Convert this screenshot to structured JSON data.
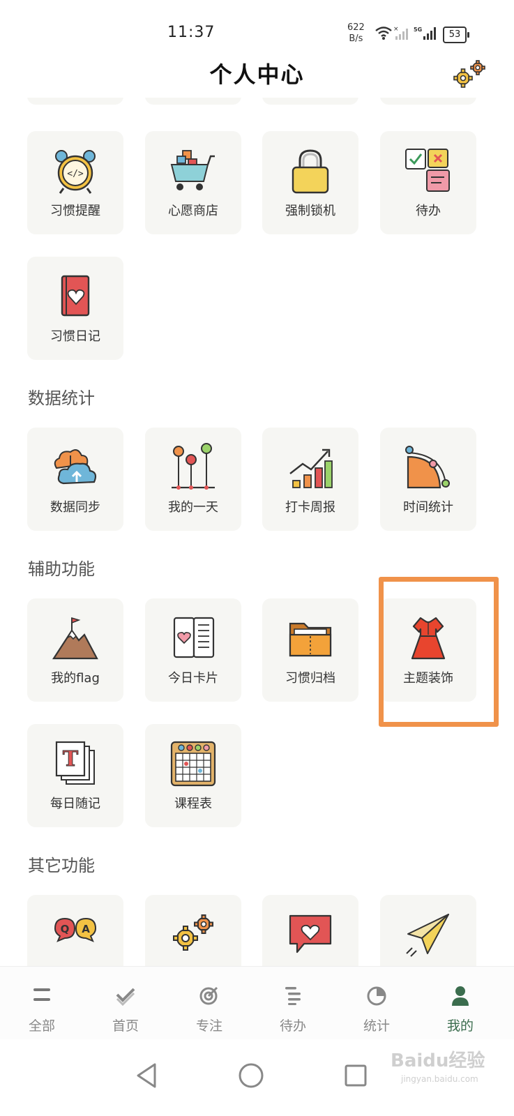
{
  "status": {
    "time": "11:37",
    "net_speed_value": "622",
    "net_speed_unit": "B/s",
    "battery": "53"
  },
  "header": {
    "title": "个人中心"
  },
  "tiles": {
    "habit_reminder": "习惯提醒",
    "wish_shop": "心愿商店",
    "force_lock": "强制锁机",
    "todo": "待办",
    "habit_diary": "习惯日记",
    "data_sync": "数据同步",
    "my_day": "我的一天",
    "weekly_report": "打卡周报",
    "time_stats": "时间统计",
    "my_flag": "我的flag",
    "daily_card": "今日卡片",
    "habit_archive": "习惯归档",
    "theme_decor": "主题装饰",
    "daily_note": "每日随记",
    "timetable": "课程表"
  },
  "sections": {
    "data_stats": "数据统计",
    "aux_functions": "辅助功能",
    "other_functions": "其它功能"
  },
  "tabbar": {
    "all": "全部",
    "home": "首页",
    "focus": "专注",
    "todo": "待办",
    "stats": "统计",
    "mine": "我的",
    "active": "我的"
  },
  "colors": {
    "accent": "#f0924a",
    "active_tab": "#3b6d4e",
    "tile_bg": "#f6f6f3"
  },
  "watermark": {
    "text": "Baidu经验",
    "sub": "jingyan.baidu.com"
  }
}
